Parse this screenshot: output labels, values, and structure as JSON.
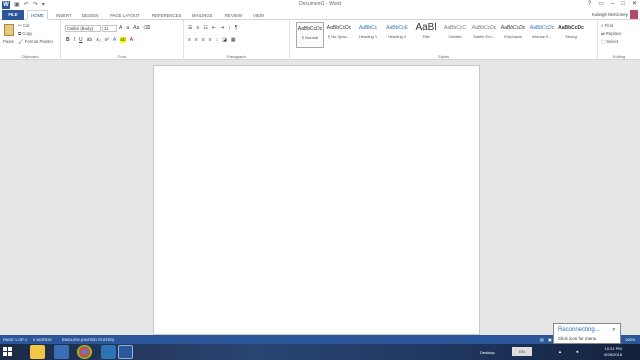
{
  "title_bar": {
    "doc_title": "Document1 - Word",
    "app_icon": "word-logo",
    "quick_access": [
      "save-icon",
      "undo-icon",
      "redo-icon"
    ]
  },
  "tabs": {
    "file": "FILE",
    "items": [
      "HOME",
      "INSERT",
      "DESIGN",
      "PAGE LAYOUT",
      "REFERENCES",
      "MAILINGS",
      "REVIEW",
      "VIEW"
    ],
    "active": "HOME"
  },
  "user": {
    "name": "Kaleigh McKinney"
  },
  "clipboard": {
    "paste": "Paste",
    "cut": "Cut",
    "copy": "Copy",
    "format_painter": "Format Painter",
    "label": "Clipboard"
  },
  "font": {
    "family": "Calibri (Body)",
    "size": "11",
    "label": "Font"
  },
  "paragraph": {
    "label": "Paragraph"
  },
  "styles": {
    "label": "Styles",
    "items": [
      {
        "preview": "AaBbCcDc",
        "name": "¶ Normal"
      },
      {
        "preview": "AaBbCcDc",
        "name": "¶ No Spac..."
      },
      {
        "preview": "AaBbCc",
        "name": "Heading 1"
      },
      {
        "preview": "AaBbCcE",
        "name": "Heading 2"
      },
      {
        "preview": "AaBl",
        "name": "Title"
      },
      {
        "preview": "AaBbCcC",
        "name": "Subtitle"
      },
      {
        "preview": "AaBbCcDc",
        "name": "Subtle Em..."
      },
      {
        "preview": "AaBbCcDc",
        "name": "Emphasis"
      },
      {
        "preview": "AaBbCcDc",
        "name": "Intense E..."
      },
      {
        "preview": "AaBbCcDc",
        "name": "Strong"
      }
    ]
  },
  "editing": {
    "find": "Find",
    "replace": "Replace",
    "select": "Select",
    "label": "Editing"
  },
  "status": {
    "page": "PAGE 1 OF 1",
    "words": "0 WORDS",
    "language": "ENGLISH (UNITED STATES)",
    "zoom": "100%"
  },
  "taskbar": {
    "desktop": "Desktop",
    "time": "10:21 PM",
    "date": "6/26/2016"
  },
  "toast": {
    "title": "Reconnecting...",
    "subtitle": "Click icon for menu"
  },
  "colors": {
    "accent": "#2b579a"
  }
}
